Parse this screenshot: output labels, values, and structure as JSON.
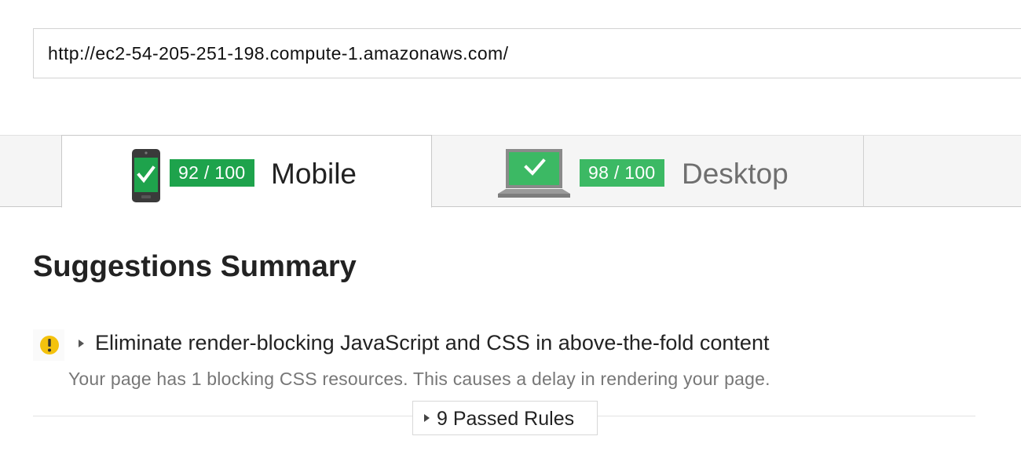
{
  "url_input": {
    "value": "http://ec2-54-205-251-198.compute-1.amazonaws.com/"
  },
  "tabs": {
    "mobile": {
      "score": "92 / 100",
      "label": "Mobile",
      "icon": "phone-check-icon",
      "selected": true
    },
    "desktop": {
      "score": "98 / 100",
      "label": "Desktop",
      "icon": "laptop-check-icon",
      "selected": false
    }
  },
  "summary": {
    "title": "Suggestions Summary"
  },
  "rules": [
    {
      "icon": "warning-icon",
      "title": "Eliminate render-blocking JavaScript and CSS in above-the-fold content",
      "description": "Your page has 1 blocking CSS resources. This causes a delay in rendering your page."
    }
  ],
  "passed_rules": {
    "label": "9 Passed Rules"
  },
  "colors": {
    "score_green": "#1ea34c",
    "score_green_light": "#3cb964",
    "warning_yellow": "#f4c20d",
    "tab_bar_bg": "#f5f5f5"
  }
}
